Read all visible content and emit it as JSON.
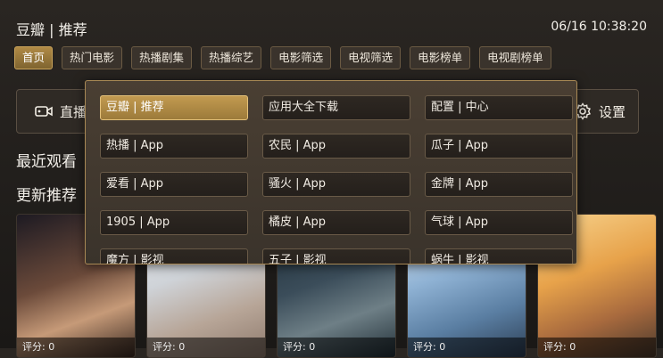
{
  "header": {
    "title": "豆瓣 | 推荐",
    "clock": "06/16 10:38:20"
  },
  "tabs": [
    "首页",
    "热门电影",
    "热播剧集",
    "热播综艺",
    "电影筛选",
    "电视筛选",
    "电影榜单",
    "电视剧榜单"
  ],
  "buttons": {
    "live": "直播",
    "settings": "设置"
  },
  "sections": {
    "recent": "最近观看",
    "recommend": "更新推荐"
  },
  "posters": [
    {
      "rating": "评分: 0",
      "tint": "#c69a78"
    },
    {
      "rating": "评分: 0",
      "tint": "#cfd3d8"
    },
    {
      "rating": "评分: 0",
      "tint": "#3b4d5a"
    },
    {
      "rating": "评分: 0",
      "tint": "#5a7ea2"
    },
    {
      "rating": "评分: 0",
      "tint": "#e7a24a"
    }
  ],
  "popup": {
    "items": [
      "豆瓣 | 推荐",
      "应用大全下载",
      "配置 | 中心",
      "热播 | App",
      "农民 | App",
      "瓜子 | App",
      "爱看 | App",
      "骚火 | App",
      "金牌 | App",
      "1905 | App",
      "橘皮 | App",
      "气球 | App",
      "魔方 | 影视",
      "五子 | 影视",
      "蜗牛 | 影视"
    ],
    "selected_index": 0
  },
  "colors": {
    "accent": "#c29a50",
    "panel": "#3a332b",
    "border": "#a98955"
  }
}
